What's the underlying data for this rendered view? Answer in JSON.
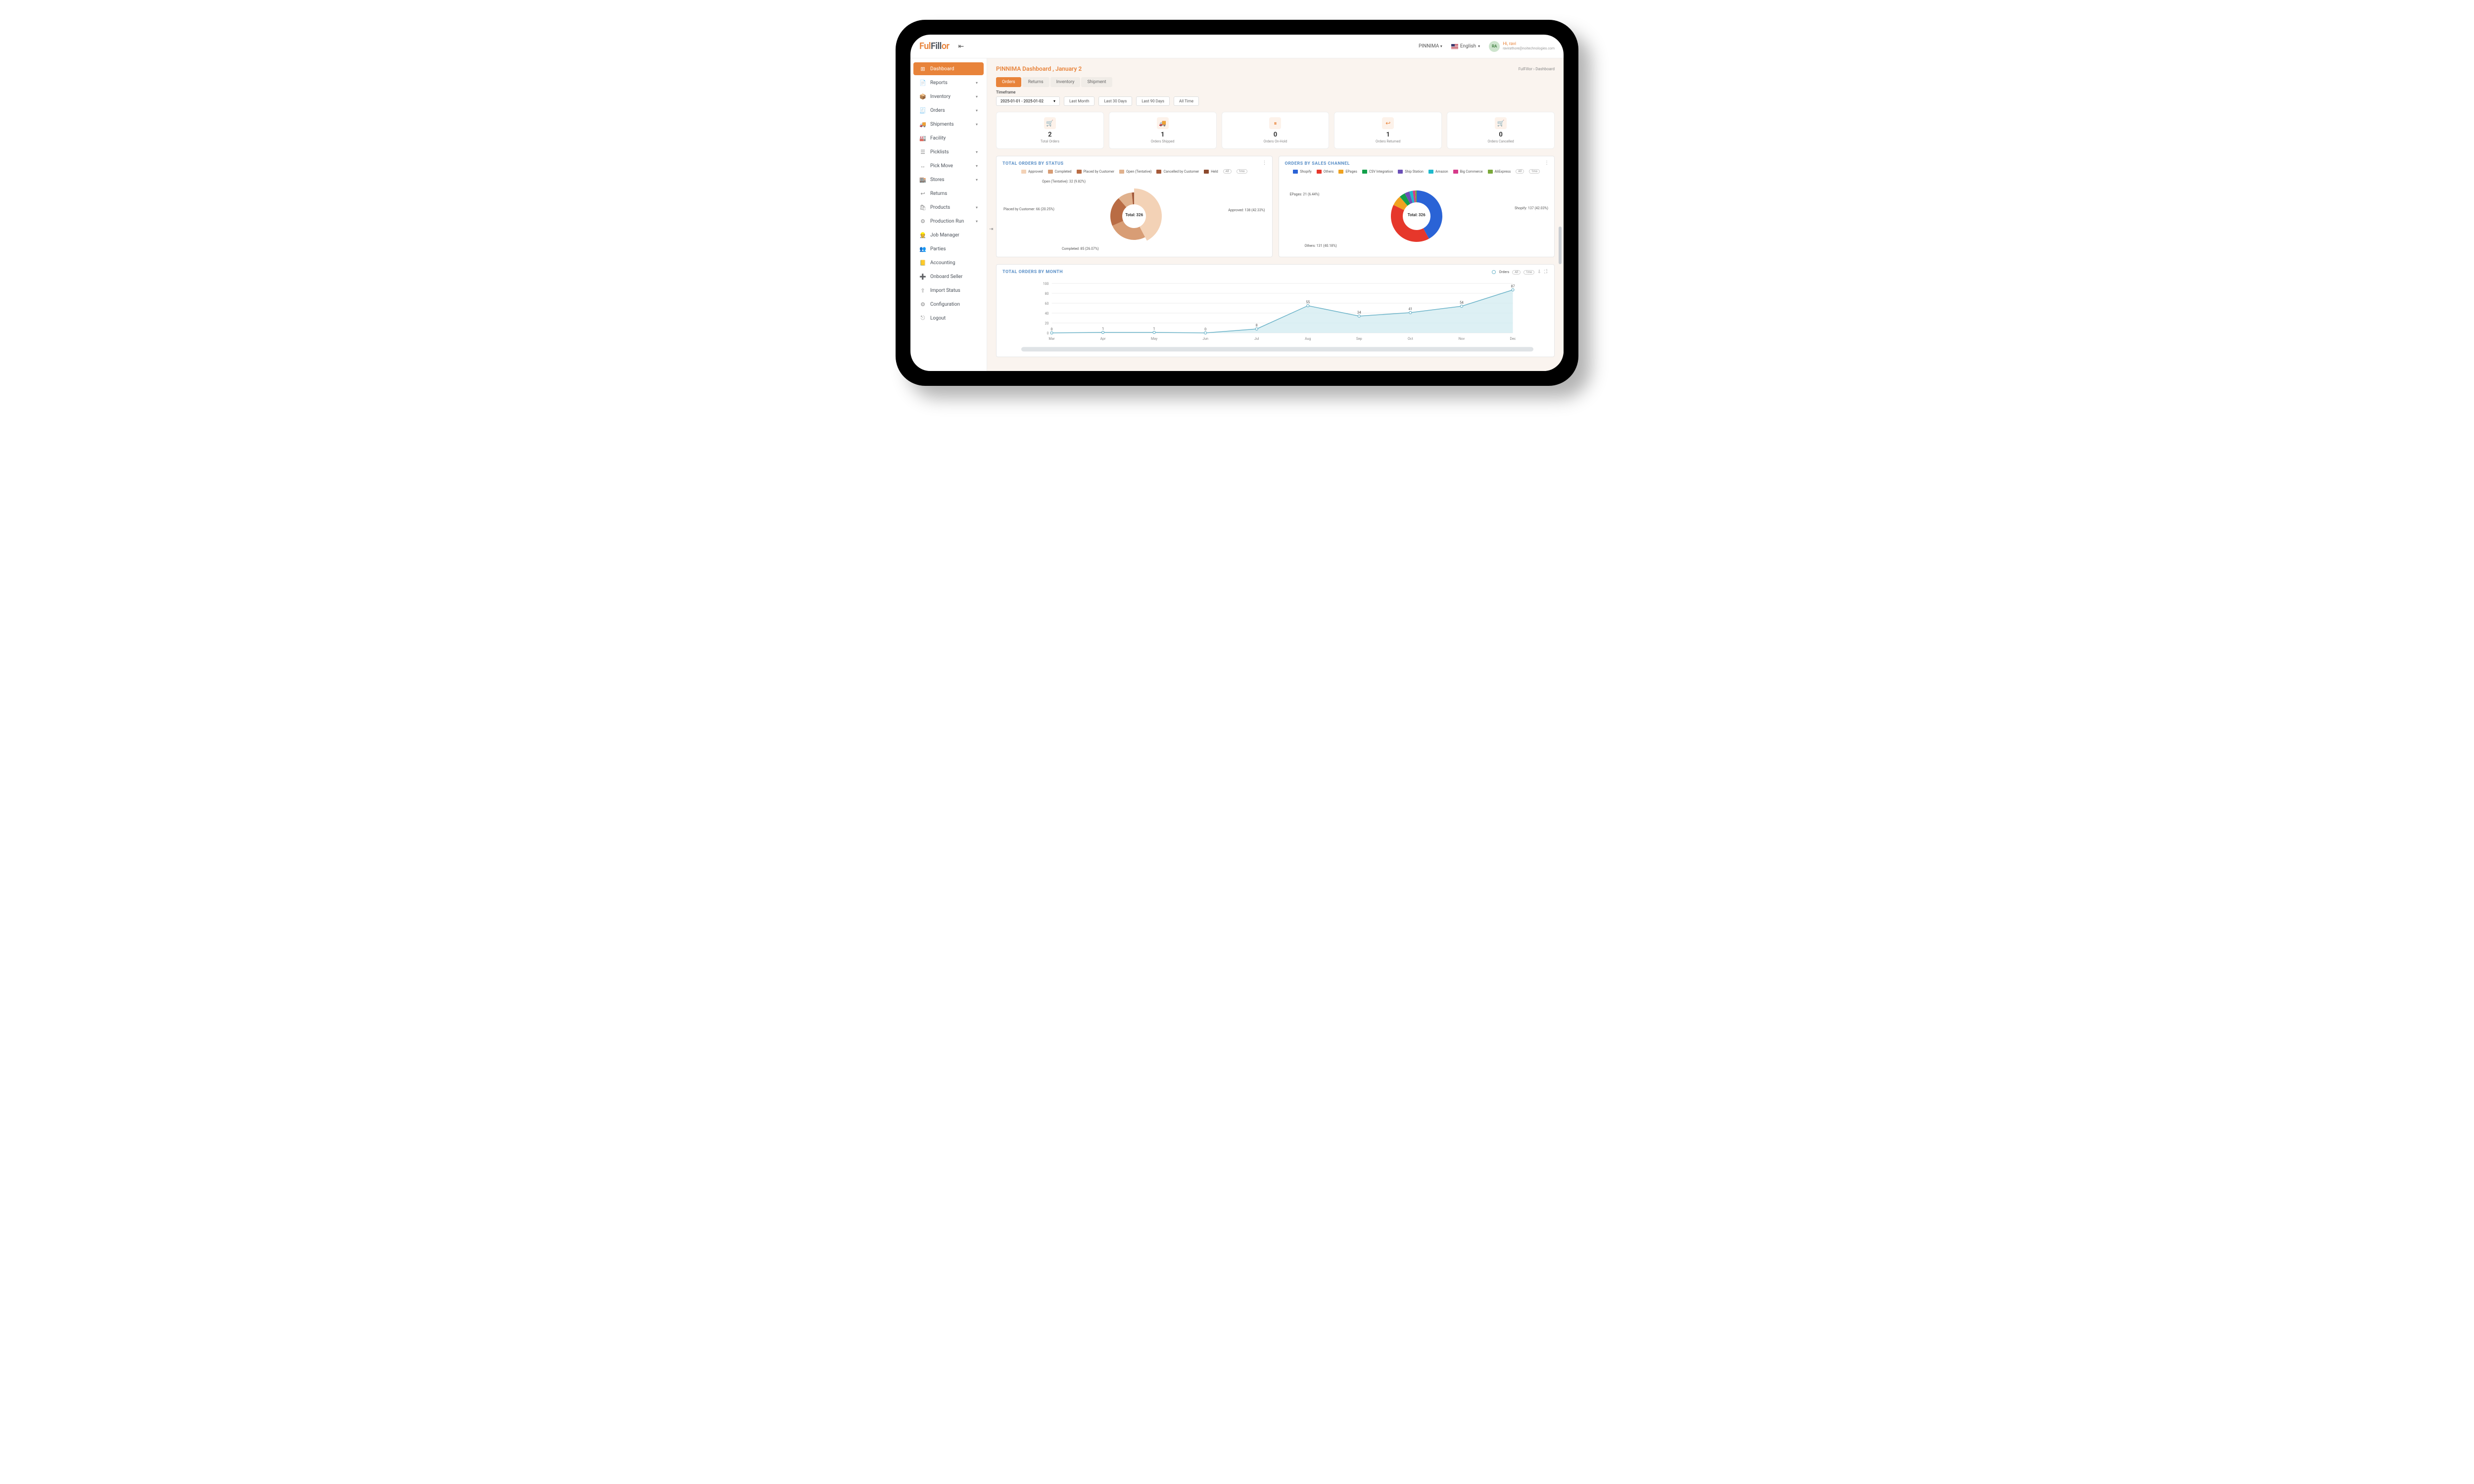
{
  "brand": {
    "part1": "Ful",
    "part2": "Fill",
    "part3": "or"
  },
  "topbar": {
    "tenant": "PINNIMA",
    "language": "English",
    "user_avatar_initials": "RA",
    "user_greeting": "Hi, ravi",
    "user_email": "ravirathore@noitechnologies.com"
  },
  "breadcrumb": {
    "root": "FulFillor",
    "sep": "›",
    "leaf": "Dashboard"
  },
  "page_title": "PINNIMA Dashboard , January 2",
  "sidebar": {
    "items": [
      {
        "label": "Dashboard",
        "icon": "⊞",
        "expandable": false,
        "active": true
      },
      {
        "label": "Reports",
        "icon": "📄",
        "expandable": true,
        "active": false
      },
      {
        "label": "Inventory",
        "icon": "📦",
        "expandable": true,
        "active": false
      },
      {
        "label": "Orders",
        "icon": "🧾",
        "expandable": true,
        "active": false
      },
      {
        "label": "Shipments",
        "icon": "🚚",
        "expandable": true,
        "active": false
      },
      {
        "label": "Facility",
        "icon": "🏭",
        "expandable": false,
        "active": false
      },
      {
        "label": "Picklists",
        "icon": "☰",
        "expandable": true,
        "active": false
      },
      {
        "label": "Pick Move",
        "icon": "↔",
        "expandable": true,
        "active": false
      },
      {
        "label": "Stores",
        "icon": "🏬",
        "expandable": true,
        "active": false
      },
      {
        "label": "Returns",
        "icon": "↩",
        "expandable": false,
        "active": false
      },
      {
        "label": "Products",
        "icon": "🛍",
        "expandable": true,
        "active": false
      },
      {
        "label": "Production Run",
        "icon": "⚙",
        "expandable": true,
        "active": false
      },
      {
        "label": "Job Manager",
        "icon": "👷",
        "expandable": false,
        "active": false
      },
      {
        "label": "Parties",
        "icon": "👥",
        "expandable": false,
        "active": false
      },
      {
        "label": "Accounting",
        "icon": "📒",
        "expandable": false,
        "active": false
      },
      {
        "label": "Onboard Seller",
        "icon": "➕",
        "expandable": false,
        "active": false
      },
      {
        "label": "Import Status",
        "icon": "⇪",
        "expandable": false,
        "active": false
      },
      {
        "label": "Configuration",
        "icon": "⚙",
        "expandable": false,
        "active": false
      },
      {
        "label": "Logout",
        "icon": "⎋",
        "expandable": false,
        "active": false
      }
    ]
  },
  "tabs": [
    {
      "label": "Orders",
      "active": true
    },
    {
      "label": "Returns",
      "active": false
    },
    {
      "label": "Inventory",
      "active": false
    },
    {
      "label": "Shipment",
      "active": false
    }
  ],
  "timeframe": {
    "label": "Timeframe",
    "range": "2025-01-01 - 2025-01-02",
    "buttons": [
      "Last Month",
      "Last 30 Days",
      "Last 90 Days",
      "All Time"
    ]
  },
  "kpis": [
    {
      "icon": "🛒",
      "value": "2",
      "label": "Total Orders"
    },
    {
      "icon": "🚚",
      "value": "1",
      "label": "Orders Shipped"
    },
    {
      "icon": "⏸",
      "value": "0",
      "label": "Orders On-Hold"
    },
    {
      "icon": "↩",
      "value": "1",
      "label": "Orders Returned"
    },
    {
      "icon": "🛒",
      "value": "0",
      "label": "Orders Cancelled"
    }
  ],
  "status_chart": {
    "title": "TOTAL ORDERS BY STATUS",
    "total_label": "Total: 326",
    "legend": [
      {
        "name": "Approved",
        "color": "#f3d2b6"
      },
      {
        "name": "Completed",
        "color": "#d89d75"
      },
      {
        "name": "Placed by Customer",
        "color": "#b96c44"
      },
      {
        "name": "Open (Tentative)",
        "color": "#e0b18d"
      },
      {
        "name": "Cancelled by Customer",
        "color": "#a55a3a"
      },
      {
        "name": "Held",
        "color": "#8c4a2d"
      }
    ],
    "pills": [
      "All",
      "1mo"
    ],
    "labels": {
      "approved": "Approved: 138 (42.33%)",
      "completed": "Completed: 85 (26.07%)",
      "placed": "Placed by Customer: 66 (20.25%)",
      "open": "Open (Tentative): 32 (9.82%)"
    }
  },
  "channel_chart": {
    "title": "ORDERS BY SALES CHANNEL",
    "total_label": "Total: 326",
    "legend": [
      {
        "name": "Shopify",
        "color": "#2a63d6"
      },
      {
        "name": "Others",
        "color": "#e6372b"
      },
      {
        "name": "EPages",
        "color": "#f0a21f"
      },
      {
        "name": "CSV Integration",
        "color": "#12a04a"
      },
      {
        "name": "Ship Station",
        "color": "#6b4fb7"
      },
      {
        "name": "Amazon",
        "color": "#1fb9cc"
      },
      {
        "name": "Big Commerce",
        "color": "#d63a8a"
      },
      {
        "name": "AliExpress",
        "color": "#7aa83a"
      }
    ],
    "pills": [
      "All",
      "1mo"
    ],
    "labels": {
      "shopify": "Shopify: 137 (42.03%)",
      "others": "Others: 131 (40.18%)",
      "epages": "EPages: 21 (6.44%)"
    }
  },
  "month_chart": {
    "title": "TOTAL ORDERS BY MONTH",
    "series_name": "Orders",
    "pills": [
      "All",
      "1mo"
    ]
  },
  "chart_data": [
    {
      "type": "pie",
      "title": "TOTAL ORDERS BY STATUS",
      "total": 326,
      "series": [
        {
          "name": "Approved",
          "value": 138,
          "pct": 42.33
        },
        {
          "name": "Completed",
          "value": 85,
          "pct": 26.07
        },
        {
          "name": "Placed by Customer",
          "value": 66,
          "pct": 20.25
        },
        {
          "name": "Open (Tentative)",
          "value": 32,
          "pct": 9.82
        },
        {
          "name": "Cancelled by Customer",
          "value": 4,
          "pct": 1.23
        },
        {
          "name": "Held",
          "value": 1,
          "pct": 0.31
        }
      ]
    },
    {
      "type": "pie",
      "title": "ORDERS BY SALES CHANNEL",
      "total": 326,
      "series": [
        {
          "name": "Shopify",
          "value": 137,
          "pct": 42.03
        },
        {
          "name": "Others",
          "value": 131,
          "pct": 40.18
        },
        {
          "name": "EPages",
          "value": 21,
          "pct": 6.44
        },
        {
          "name": "CSV Integration",
          "value": 12,
          "pct": 3.68
        },
        {
          "name": "Ship Station",
          "value": 10,
          "pct": 3.07
        },
        {
          "name": "Amazon",
          "value": 7,
          "pct": 2.15
        },
        {
          "name": "Big Commerce",
          "value": 5,
          "pct": 1.53
        },
        {
          "name": "AliExpress",
          "value": 3,
          "pct": 0.92
        }
      ]
    },
    {
      "type": "line",
      "title": "TOTAL ORDERS BY MONTH",
      "xlabel": "",
      "ylabel": "",
      "ylim": [
        0,
        100
      ],
      "categories": [
        "Mar",
        "Apr",
        "May",
        "Jun",
        "Jul",
        "Aug",
        "Sep",
        "Oct",
        "Nov",
        "Dec"
      ],
      "series": [
        {
          "name": "Orders",
          "values": [
            0,
            1,
            1,
            0,
            8,
            55,
            34,
            41,
            54,
            87
          ]
        }
      ]
    }
  ]
}
